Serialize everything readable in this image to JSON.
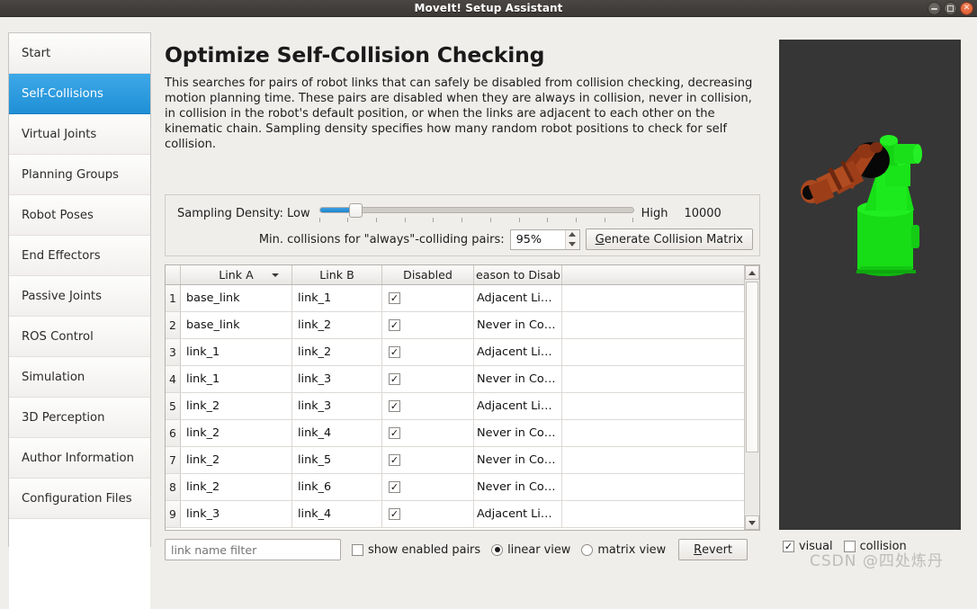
{
  "window": {
    "title": "MoveIt! Setup Assistant",
    "buttons": {
      "minimize": "minimize",
      "maximize": "maximize",
      "close": "close"
    }
  },
  "sidebar": {
    "items": [
      {
        "label": "Start",
        "selected": false
      },
      {
        "label": "Self-Collisions",
        "selected": true
      },
      {
        "label": "Virtual Joints",
        "selected": false
      },
      {
        "label": "Planning Groups",
        "selected": false
      },
      {
        "label": "Robot Poses",
        "selected": false
      },
      {
        "label": "End Effectors",
        "selected": false
      },
      {
        "label": "Passive Joints",
        "selected": false
      },
      {
        "label": "ROS Control",
        "selected": false
      },
      {
        "label": "Simulation",
        "selected": false
      },
      {
        "label": "3D Perception",
        "selected": false
      },
      {
        "label": "Author Information",
        "selected": false
      },
      {
        "label": "Configuration Files",
        "selected": false
      }
    ]
  },
  "main": {
    "title": "Optimize Self-Collision Checking",
    "description": "This searches for pairs of robot links that can safely be disabled from collision checking, decreasing motion planning time. These pairs are disabled when they are always in collision, never in collision, in collision in the robot's default position, or when the links are adjacent to each other on the kinematic chain. Sampling density specifies how many random robot positions to check for self collision.",
    "sampling": {
      "label": "Sampling Density: Low",
      "high_label": "High",
      "value": "10000",
      "slider_percent": 10
    },
    "min_collisions": {
      "label": "Min. collisions for \"always\"-colliding pairs:",
      "value": "95%",
      "generate_button": "Generate Collision Matrix",
      "generate_button_accel": "G",
      "generate_button_rest": "enerate Collision Matrix"
    },
    "table": {
      "headers": [
        "",
        "Link A",
        "Link B",
        "Disabled",
        "eason to Disab",
        ""
      ],
      "sort_column": "Link A",
      "sort_direction": "descending",
      "rows": [
        {
          "index": "1",
          "link_a": "base_link",
          "link_b": "link_1",
          "disabled": true,
          "reason": "Adjacent Li…"
        },
        {
          "index": "2",
          "link_a": "base_link",
          "link_b": "link_2",
          "disabled": true,
          "reason": "Never in Co…"
        },
        {
          "index": "3",
          "link_a": "link_1",
          "link_b": "link_2",
          "disabled": true,
          "reason": "Adjacent Li…"
        },
        {
          "index": "4",
          "link_a": "link_1",
          "link_b": "link_3",
          "disabled": true,
          "reason": "Never in Co…"
        },
        {
          "index": "5",
          "link_a": "link_2",
          "link_b": "link_3",
          "disabled": true,
          "reason": "Adjacent Li…"
        },
        {
          "index": "6",
          "link_a": "link_2",
          "link_b": "link_4",
          "disabled": true,
          "reason": "Never in Co…"
        },
        {
          "index": "7",
          "link_a": "link_2",
          "link_b": "link_5",
          "disabled": true,
          "reason": "Never in Co…"
        },
        {
          "index": "8",
          "link_a": "link_2",
          "link_b": "link_6",
          "disabled": true,
          "reason": "Never in Co…"
        },
        {
          "index": "9",
          "link_a": "link_3",
          "link_b": "link_4",
          "disabled": true,
          "reason": "Adjacent Li…"
        }
      ],
      "checkmark": "✓"
    },
    "bottom_bar": {
      "filter_placeholder": "link name filter",
      "filter_value": "",
      "show_enabled_pairs": {
        "label": "show enabled pairs",
        "checked": false
      },
      "linear_view": {
        "label": "linear view",
        "selected": true
      },
      "matrix_view": {
        "label": "matrix view",
        "selected": false
      },
      "revert_button": "Revert",
      "revert_accel": "R",
      "revert_rest": "evert"
    }
  },
  "viewport": {
    "visual": {
      "label": "visual",
      "checked": true
    },
    "collision": {
      "label": "collision",
      "checked": false
    },
    "background_color": "#363636",
    "robot_base_color": "#16dd16",
    "robot_arm_color": "#a8441c"
  },
  "watermark": {
    "text": "CSDN @四处炼丹"
  }
}
